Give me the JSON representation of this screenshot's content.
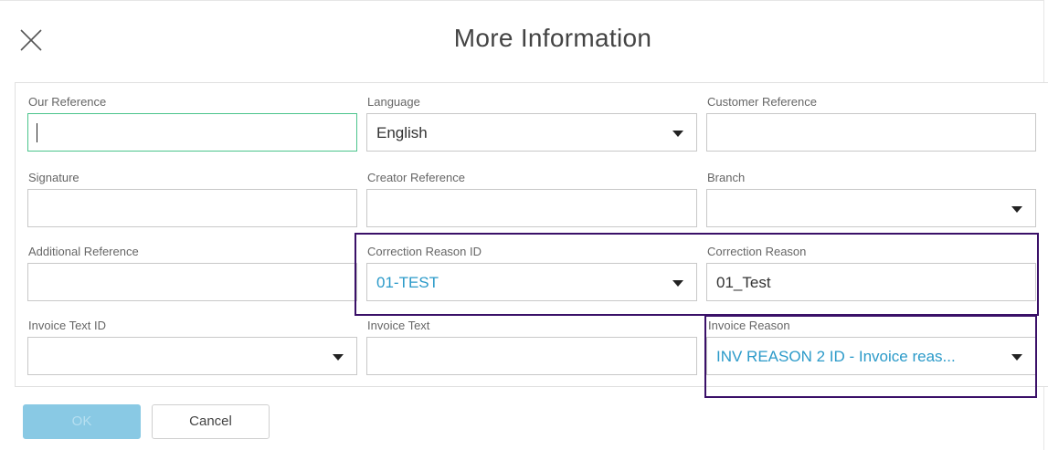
{
  "dialog": {
    "title": "More Information",
    "close_icon": "close-icon"
  },
  "fields": {
    "our_reference": {
      "label": "Our Reference",
      "value": ""
    },
    "language": {
      "label": "Language",
      "value": "English"
    },
    "customer_reference": {
      "label": "Customer Reference",
      "value": ""
    },
    "signature": {
      "label": "Signature",
      "value": ""
    },
    "creator_reference": {
      "label": "Creator Reference",
      "value": ""
    },
    "branch": {
      "label": "Branch",
      "value": ""
    },
    "additional_reference": {
      "label": "Additional Reference",
      "value": ""
    },
    "correction_reason_id": {
      "label": "Correction Reason ID",
      "value": "01-TEST"
    },
    "correction_reason": {
      "label": "Correction Reason",
      "value": "01_Test"
    },
    "invoice_text_id": {
      "label": "Invoice Text ID",
      "value": ""
    },
    "invoice_text": {
      "label": "Invoice Text",
      "value": ""
    },
    "invoice_reason": {
      "label": "Invoice Reason",
      "value": "INV REASON 2 ID - Invoice reas..."
    }
  },
  "buttons": {
    "ok": "OK",
    "cancel": "Cancel"
  },
  "colors": {
    "link_value": "#2b9ac9",
    "focus_border": "#4bc48c",
    "highlight": "#3a1068",
    "ok_button": "#89c9e4"
  }
}
